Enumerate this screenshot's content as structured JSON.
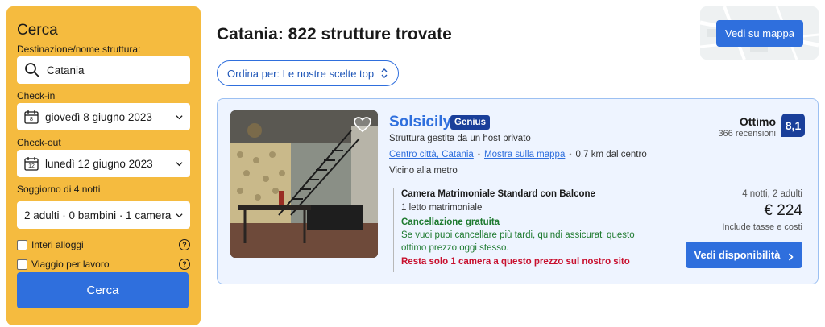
{
  "sidebar": {
    "title": "Cerca",
    "destination_label": "Destinazione/nome struttura:",
    "destination_value": "Catania",
    "checkin_label": "Check-in",
    "checkin_value": "giovedì 8 giugno 2023",
    "checkin_day": "8",
    "checkout_label": "Check-out",
    "checkout_value": "lunedì 12 giugno 2023",
    "checkout_day": "12",
    "stay_label": "Soggiorno di 4 notti",
    "guests_value": "2 adulti · 0 bambini · 1 camera",
    "checkbox_whole_homes": "Interi alloggi",
    "checkbox_business": "Viaggio per lavoro",
    "help_glyph": "?",
    "search_button": "Cerca"
  },
  "header": {
    "results_title": "Catania: 822 strutture trovate",
    "sort_label": "Ordina per: Le nostre scelte top",
    "map_button": "Vedi su mappa"
  },
  "property": {
    "name": "Solsicily",
    "badge": "Genius",
    "subtitle": "Struttura gestita da un host privato",
    "location_link": "Centro città, Catania",
    "map_link": "Mostra sulla mappa",
    "distance": "0,7 km dal centro",
    "nearby": "Vicino alla metro",
    "rating_word": "Ottimo",
    "reviews": "366 recensioni",
    "score": "8,1",
    "room_type": "Camera Matrimoniale Standard con Balcone",
    "beds": "1 letto matrimoniale",
    "cancellation": "Cancellazione gratuita",
    "cancellation_note_1": "Se vuoi puoi cancellare più tardi, quindi assicurati questo",
    "cancellation_note_2": "ottimo prezzo oggi stesso.",
    "scarcity": "Resta solo 1 camera a questo prezzo sul nostro sito",
    "stay_summary": "4 notti, 2 adulti",
    "price": "€ 224",
    "taxes": "Include tasse e costi",
    "availability_button": "Vedi disponibilità"
  },
  "colors": {
    "sidebar_bg": "#f5bb3f",
    "primary_blue": "#2f6fdd",
    "dark_blue": "#1a3f9a",
    "green": "#1e7a2f",
    "red": "#c8102e"
  }
}
